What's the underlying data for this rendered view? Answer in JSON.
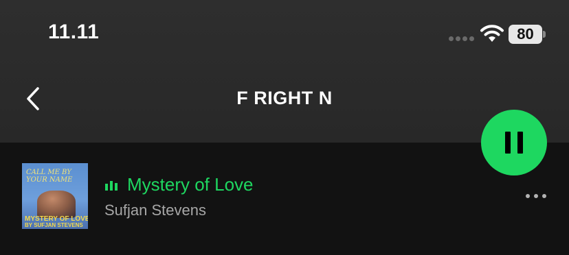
{
  "status_bar": {
    "time": "11.11",
    "battery_percent": "80"
  },
  "header": {
    "title": "F RIGHT N",
    "back_icon": "chevron-left-icon"
  },
  "player": {
    "play_state_icon": "pause-icon",
    "accent_color": "#1ed760"
  },
  "tracks": [
    {
      "title": "Mystery of Love",
      "artist": "Sufjan Stevens",
      "is_playing": true,
      "album_art": {
        "cover_title": "CALL ME BY YOUR NAME",
        "cover_line1": "MYSTERY OF LOVE",
        "cover_line2": "BY SUFJAN STEVENS"
      }
    }
  ]
}
